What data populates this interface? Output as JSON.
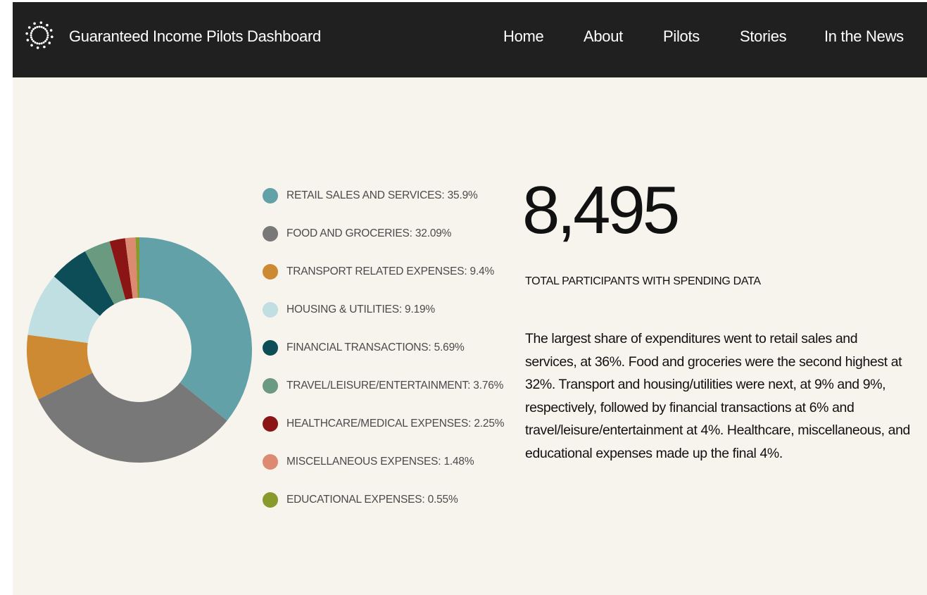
{
  "header": {
    "site_title": "Guaranteed Income Pilots Dashboard",
    "logo_icon": "dotted-circle-logo-icon",
    "nav": [
      {
        "label": "Home"
      },
      {
        "label": "About"
      },
      {
        "label": "Pilots"
      },
      {
        "label": "Stories"
      },
      {
        "label": "In the News"
      }
    ]
  },
  "stats": {
    "big_number": "8,495",
    "label": "TOTAL PARTICIPANTS WITH SPENDING DATA",
    "description": "The largest share of expenditures went to retail sales and services, at 36%. Food and groceries were the second highest at 32%. Transport and housing/utilities were next, at 9% and 9%, respectively, followed by financial transactions at 6% and travel/leisure/entertainment at 4%. Healthcare, miscellaneous, and educational expenses made up the final 4%."
  },
  "chart_data": {
    "type": "pie",
    "donut": true,
    "legend_position": "right",
    "slices": [
      {
        "label": "RETAIL SALES AND SERVICES: 35.9%",
        "value": 35.9,
        "color": "#62a1a8"
      },
      {
        "label": "FOOD AND GROCERIES: 32.09%",
        "value": 32.09,
        "color": "#787878"
      },
      {
        "label": "TRANSPORT RELATED EXPENSES: 9.4%",
        "value": 9.4,
        "color": "#cd8a33"
      },
      {
        "label": "HOUSING & UTILITIES: 9.19%",
        "value": 9.19,
        "color": "#c0dfe3"
      },
      {
        "label": "FINANCIAL TRANSACTIONS: 5.69%",
        "value": 5.69,
        "color": "#0c4d58"
      },
      {
        "label": "TRAVEL/LEISURE/ENTERTAINMENT: 3.76%",
        "value": 3.76,
        "color": "#6a9a80"
      },
      {
        "label": "HEALTHCARE/MEDICAL EXPENSES: 2.25%",
        "value": 2.25,
        "color": "#8b1414"
      },
      {
        "label": "MISCELLANEOUS EXPENSES: 1.48%",
        "value": 1.48,
        "color": "#dc8a72"
      },
      {
        "label": "EDUCATIONAL EXPENSES: 0.55%",
        "value": 0.55,
        "color": "#889a2c"
      }
    ]
  }
}
